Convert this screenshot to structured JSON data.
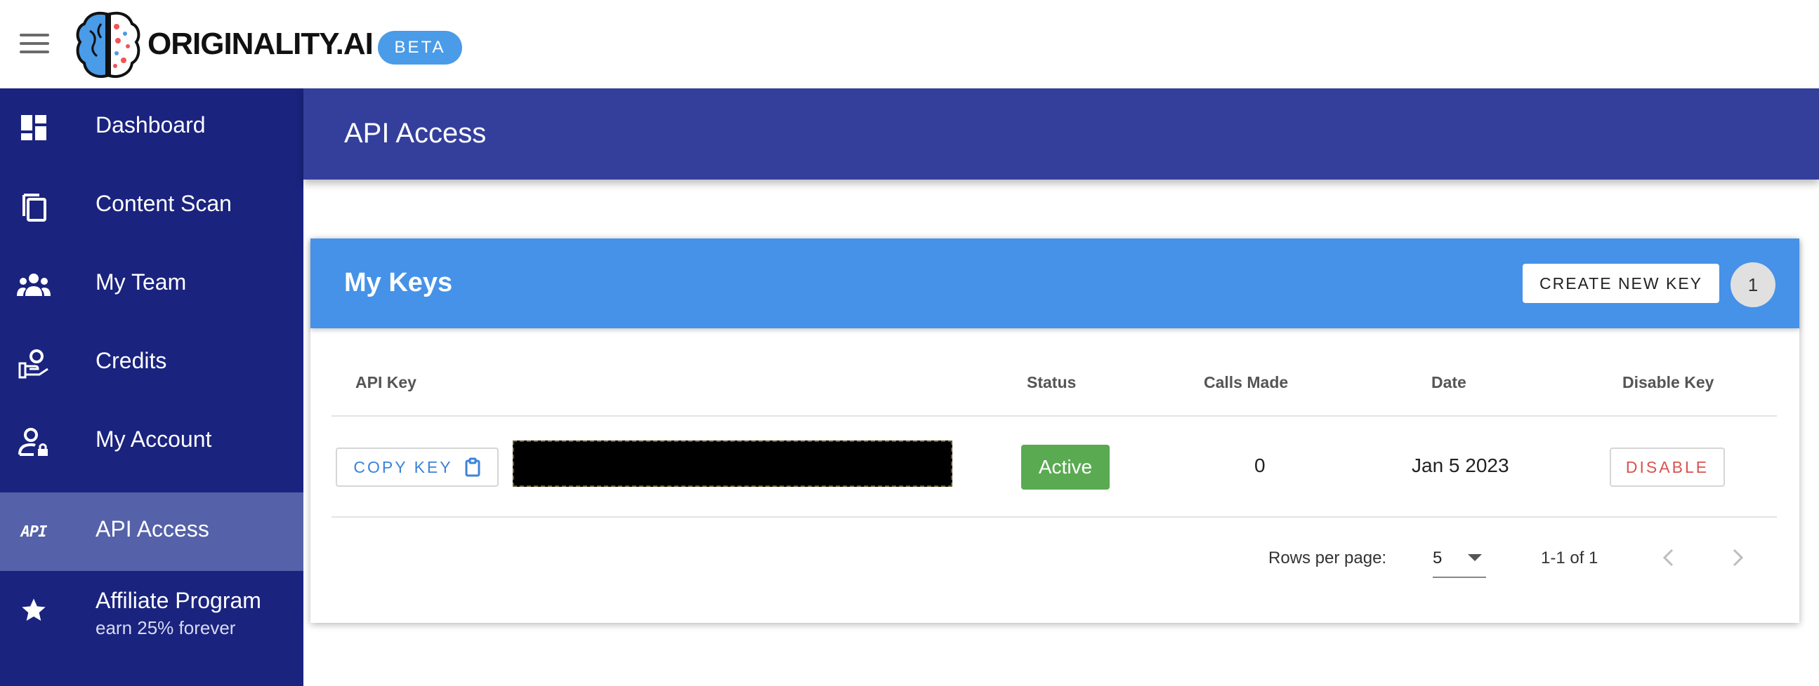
{
  "topbar": {
    "menu_icon": "hamburger-menu-icon",
    "logo_text": "ORIGINALITY.AI",
    "beta_label": "BETA"
  },
  "sidebar": {
    "items": [
      {
        "label": "Dashboard",
        "icon": "dashboard-icon"
      },
      {
        "label": "Content Scan",
        "icon": "copy-icon"
      },
      {
        "label": "My Team",
        "icon": "team-icon"
      },
      {
        "label": "Credits",
        "icon": "credits-hand-icon"
      },
      {
        "label": "My Account",
        "icon": "account-lock-icon"
      },
      {
        "label": "API Access",
        "icon": "api-icon",
        "glyph": "API",
        "active": true
      },
      {
        "label": "Affiliate Program",
        "sublabel": "earn 25% forever",
        "icon": "star-icon"
      }
    ]
  },
  "page": {
    "title": "API Access"
  },
  "keys_card": {
    "title": "My Keys",
    "create_button": "CREATE NEW KEY",
    "count": "1",
    "columns": [
      "API Key",
      "Status",
      "Calls Made",
      "Date",
      "Disable Key"
    ],
    "rows": [
      {
        "copy_label": "COPY KEY",
        "status": "Active",
        "calls_made": "0",
        "date": "Jan 5 2023",
        "disable_label": "DISABLE"
      }
    ],
    "pagination": {
      "rows_per_page_label": "Rows per page:",
      "rows_per_page": "5",
      "range": "1-1 of 1"
    }
  },
  "colors": {
    "sidebar_bg": "#1a237e",
    "sidebar_active": "#5561a8",
    "header_bg": "#343f9c",
    "card_header_bg": "#4592e8",
    "beta_bg": "#4a9be8",
    "status_active": "#5aaa52",
    "disable_red": "#d9534f",
    "copy_blue": "#3b83d8"
  }
}
